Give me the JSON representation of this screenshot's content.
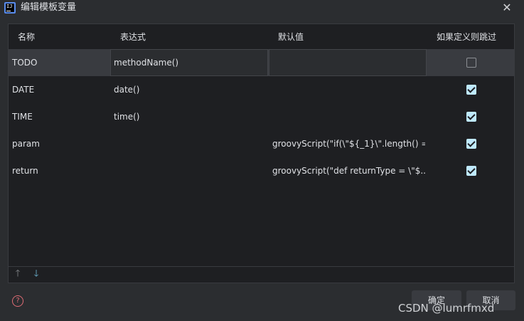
{
  "window": {
    "title": "编辑模板变量",
    "app_icon_text": "IJ"
  },
  "columns": [
    "名称",
    "表达式",
    "默认值",
    "如果定义则跳过"
  ],
  "rows": [
    {
      "name": "TODO",
      "expression": "methodName()",
      "default": "",
      "skip": false
    },
    {
      "name": "DATE",
      "expression": "date()",
      "default": "",
      "skip": true
    },
    {
      "name": "TIME",
      "expression": "time()",
      "default": "",
      "skip": true
    },
    {
      "name": "param",
      "expression": "",
      "default": "groovyScript(\"if(\\\"${_1}\\\".length() =...",
      "skip": true
    },
    {
      "name": "return",
      "expression": "",
      "default": "groovyScript(\"def returnType = \\\"$...",
      "skip": true
    }
  ],
  "buttons": {
    "ok": "确定",
    "cancel": "取消"
  },
  "watermark": "CSDN @lumrfmxd",
  "icons": {
    "close": "close-icon",
    "help": "help-icon",
    "up": "arrow-up-icon",
    "down": "arrow-down-icon"
  },
  "colors": {
    "background": "#2b2d30",
    "table": "#1e1f22",
    "selected_row": "#393b40",
    "checkbox": "#bfe9ff",
    "help": "#e06c75"
  }
}
